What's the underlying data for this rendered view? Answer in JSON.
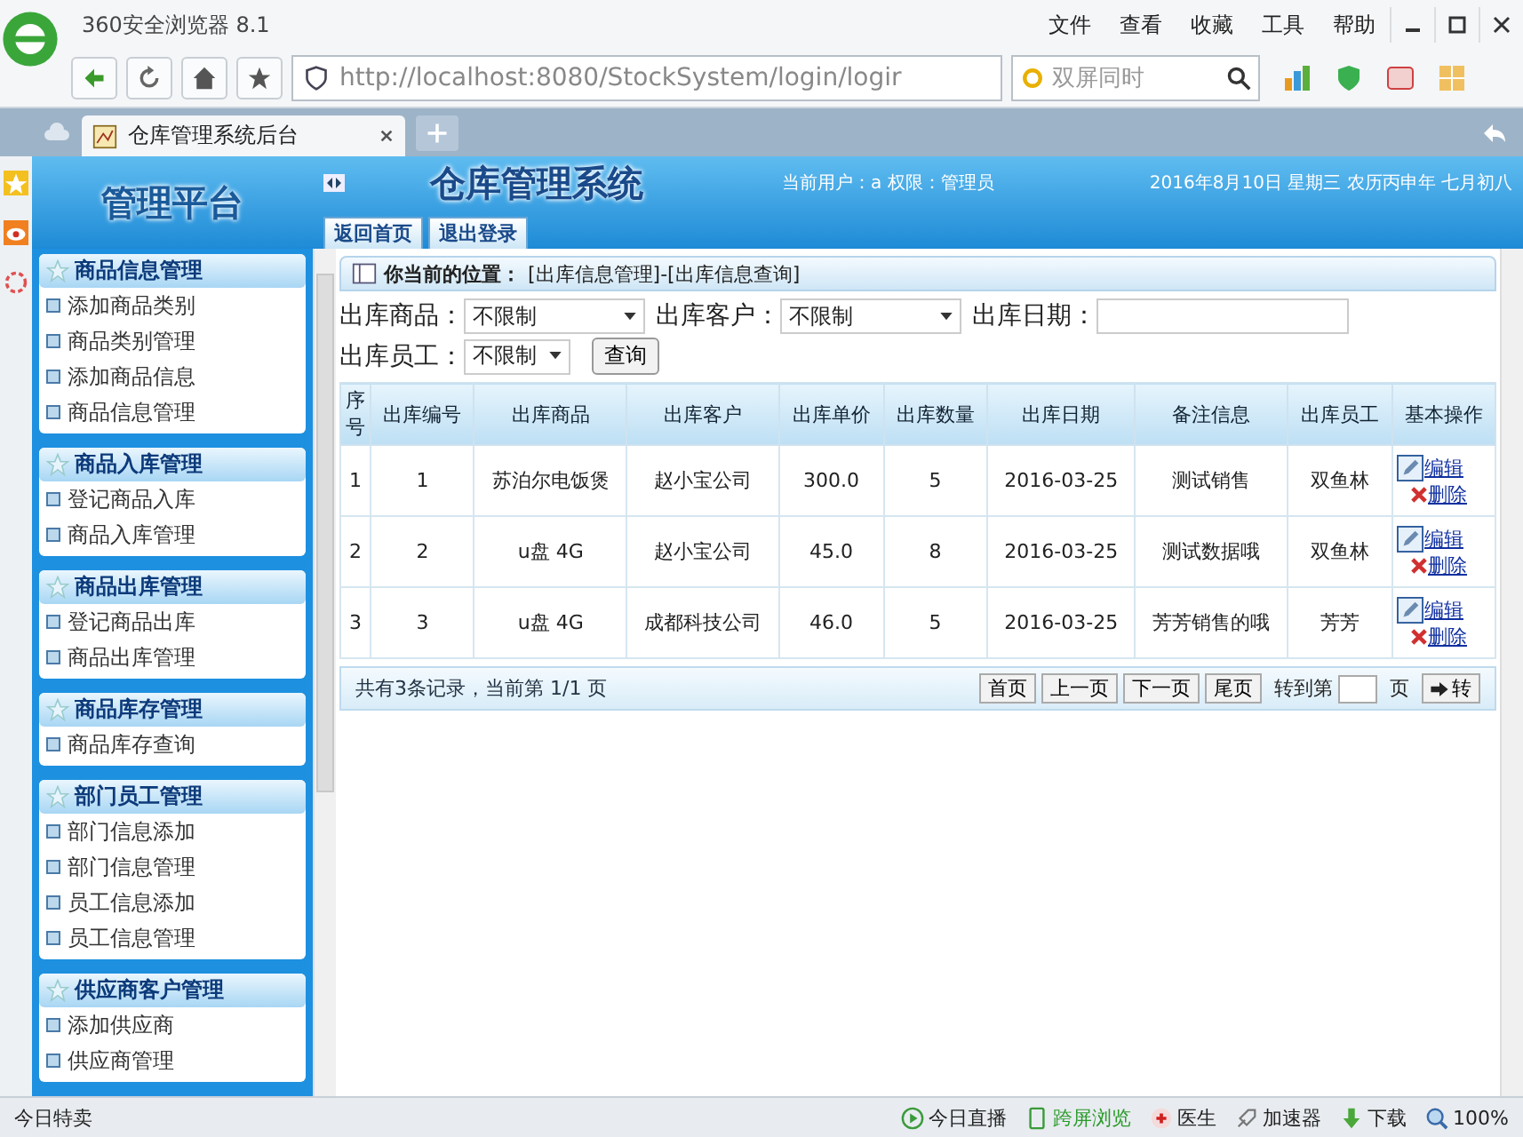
{
  "browser": {
    "title": "360安全浏览器 8.1",
    "menu": [
      "文件",
      "查看",
      "收藏",
      "工具",
      "帮助"
    ],
    "address": "http://localhost:8080/StockSystem/login/logir",
    "search_placeholder": "双屏同时",
    "tabs": [
      {
        "label": "仓库管理系统后台",
        "selected": true
      }
    ],
    "status_left": "今日特卖",
    "status_items": [
      {
        "kind": "play",
        "label": "今日直播"
      },
      {
        "kind": "phone",
        "label": "跨屏浏览"
      },
      {
        "kind": "doctor",
        "label": "医生"
      },
      {
        "kind": "rocket",
        "label": "加速器"
      },
      {
        "kind": "download",
        "label": "下载"
      },
      {
        "kind": "zoom",
        "label": "100%"
      }
    ]
  },
  "header": {
    "brand": "管理平台",
    "title": "仓库管理系统",
    "user_info": "当前用户：a 权限：管理员",
    "date": "2016年8月10日 星期三 农历丙申年 七月初八",
    "nav": [
      "返回首页",
      "退出登录"
    ]
  },
  "sidebar": [
    {
      "title": "商品信息管理",
      "items": [
        "添加商品类别",
        "商品类别管理",
        "添加商品信息",
        "商品信息管理"
      ]
    },
    {
      "title": "商品入库管理",
      "items": [
        "登记商品入库",
        "商品入库管理"
      ]
    },
    {
      "title": "商品出库管理",
      "items": [
        "登记商品出库",
        "商品出库管理"
      ]
    },
    {
      "title": "商品库存管理",
      "items": [
        "商品库存查询"
      ]
    },
    {
      "title": "部门员工管理",
      "items": [
        "部门信息添加",
        "部门信息管理",
        "员工信息添加",
        "员工信息管理"
      ]
    },
    {
      "title": "供应商客户管理",
      "items": [
        "添加供应商",
        "供应商管理"
      ]
    }
  ],
  "breadcrumb": {
    "label": "你当前的位置：",
    "path": "[出库信息管理]-[出库信息查询]"
  },
  "filters": [
    {
      "label": "出库商品：",
      "kind": "select",
      "value": "不限制"
    },
    {
      "label": "出库客户：",
      "kind": "select",
      "value": "不限制"
    },
    {
      "label": "出库日期：",
      "kind": "date"
    },
    {
      "label": "出库员工：",
      "kind": "select",
      "value": "不限制"
    }
  ],
  "query_button": "查询",
  "table": {
    "columns": [
      "序号",
      "出库编号",
      "出库商品",
      "出库客户",
      "出库单价",
      "出库数量",
      "出库日期",
      "备注信息",
      "出库员工",
      "基本操作"
    ],
    "rows": [
      {
        "cells": [
          "1",
          "1",
          "苏泊尔电饭煲",
          "赵小宝公司",
          "300.0",
          "5",
          "2016-03-25",
          "测试销售",
          "双鱼林"
        ],
        "actions": [
          "编辑",
          "删除"
        ]
      },
      {
        "cells": [
          "2",
          "2",
          "u盘 4G",
          "赵小宝公司",
          "45.0",
          "8",
          "2016-03-25",
          "测试数据哦",
          "双鱼林"
        ],
        "actions": [
          "编辑",
          "删除"
        ]
      },
      {
        "cells": [
          "3",
          "3",
          "u盘 4G",
          "成都科技公司",
          "46.0",
          "5",
          "2016-03-25",
          "芳芳销售的哦",
          "芳芳"
        ],
        "actions": [
          "编辑",
          "删除"
        ]
      }
    ]
  },
  "pager": {
    "summary": "共有3条记录，当前第 1/1 页",
    "buttons": [
      "首页",
      "上一页",
      "下一页",
      "尾页"
    ],
    "goto_label": "转到第",
    "page_suffix": "页",
    "go_button": "转"
  }
}
